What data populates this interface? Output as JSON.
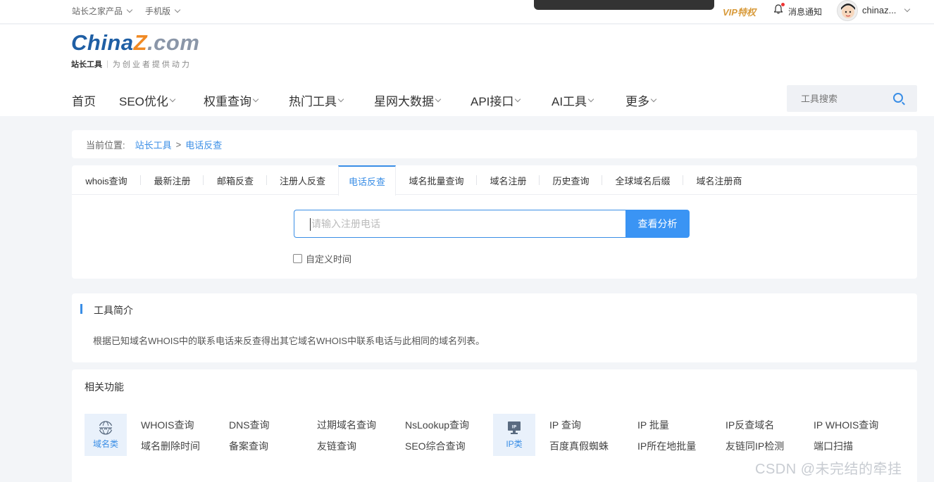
{
  "topbar": {
    "products": "站长之家产品",
    "mobile": "手机版",
    "vip": "VIP特权",
    "notify": "消息通知",
    "username": "chinaz..."
  },
  "logo": {
    "part1": "China",
    "part2": "Z",
    "part3": ".com",
    "tagline_bold": "站长工具",
    "tagline": "为创业者提供动力"
  },
  "nav": {
    "items": [
      {
        "label": "首页",
        "dropdown": false
      },
      {
        "label": "SEO优化",
        "dropdown": true
      },
      {
        "label": "权重查询",
        "dropdown": true
      },
      {
        "label": "热门工具",
        "dropdown": true
      },
      {
        "label": "星网大数据",
        "dropdown": true
      },
      {
        "label": "API接口",
        "dropdown": true
      },
      {
        "label": "AI工具",
        "dropdown": true
      },
      {
        "label": "更多",
        "dropdown": true
      }
    ],
    "search_placeholder": "工具搜索"
  },
  "breadcrumb": {
    "prefix": "当前位置:",
    "root": "站长工具",
    "sep": ">",
    "current": "电话反查"
  },
  "tabs": [
    "whois查询",
    "最新注册",
    "邮箱反查",
    "注册人反查",
    "电话反查",
    "域名批量查询",
    "域名注册",
    "历史查询",
    "全球域名后缀",
    "域名注册商"
  ],
  "active_tab": 4,
  "query": {
    "placeholder": "请输入注册电话",
    "button": "查看分析",
    "custom_time": "自定义时间"
  },
  "intro": {
    "title": "工具简介",
    "desc": "根据已知域名WHOIS中的联系电话来反查得出其它域名WHOIS中联系电话与此相同的域名列表。"
  },
  "related": {
    "title": "相关功能",
    "domain_cat": {
      "label": "域名类",
      "icon": "www"
    },
    "domain_links": [
      [
        "WHOIS查询",
        "DNS查询",
        "过期域名查询",
        "NsLookup查询"
      ],
      [
        "域名删除时间",
        "备案查询",
        "友链查询",
        "SEO综合查询"
      ]
    ],
    "ip_cat": {
      "label": "IP类",
      "icon": "IP"
    },
    "ip_links": [
      [
        "IP 查询",
        "IP 批量",
        "IP反查域名",
        "IP WHOIS查询"
      ],
      [
        "百度真假蜘蛛",
        "IP所在地批量",
        "友链同IP检测",
        "端口扫描"
      ]
    ]
  },
  "watermark": "CSDN @未完结的牵挂",
  "colors": {
    "accent": "#3a8ee6",
    "button": "#3a94f4",
    "vip": "#d89a3a",
    "logo_blue": "#1f5fa5",
    "logo_orange": "#f08a24"
  }
}
